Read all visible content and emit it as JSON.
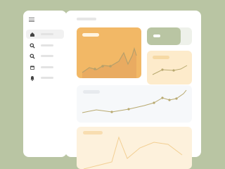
{
  "theme": {
    "background": "#b9c5a3",
    "panel": "#ffffff",
    "accent_orange": "#f2b866",
    "accent_light": "#fbe7c4",
    "accent_pale": "#fdf1dc",
    "line_olive": "#b8a96f",
    "gray_card": "#f6f8fa"
  },
  "sidebar": {
    "menu_icon": "hamburger-icon",
    "items": [
      {
        "icon": "home-icon",
        "active": true
      },
      {
        "icon": "search-icon",
        "active": false
      },
      {
        "icon": "search-icon",
        "active": false
      },
      {
        "icon": "calendar-icon",
        "active": false
      },
      {
        "icon": "bell-icon",
        "active": false
      }
    ]
  },
  "main": {
    "toggle": {
      "state": "left"
    }
  }
}
